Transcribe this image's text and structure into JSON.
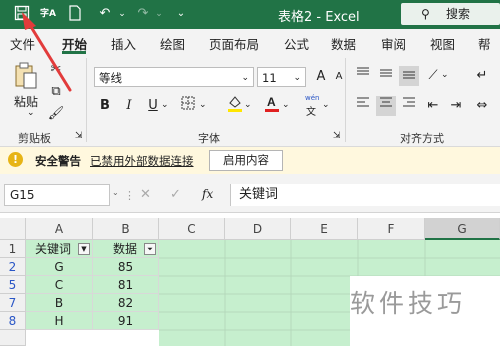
{
  "titlebar": {
    "save_icon": "save-icon",
    "spell_label": "字A",
    "doc_title": "表格2 - Excel",
    "search_placeholder": "搜索(Alt+Q)"
  },
  "tabs": [
    "文件",
    "开始",
    "插入",
    "绘图",
    "页面布局",
    "公式",
    "数据",
    "审阅",
    "视图",
    "帮助"
  ],
  "ribbon": {
    "clipboard": {
      "paste_label": "粘贴",
      "group_label": "剪贴板"
    },
    "font": {
      "font_name": "等线",
      "font_size": "11",
      "grow": "A",
      "shrink": "A",
      "bold": "B",
      "italic": "I",
      "underline": "U",
      "wen": "wén",
      "wen2": "文",
      "group_label": "字体"
    },
    "alignment": {
      "group_label": "对齐方式"
    }
  },
  "warning": {
    "title": "安全警告",
    "message": "已禁用外部数据连接",
    "button": "启用内容"
  },
  "formula": {
    "name_box": "G15",
    "fx": "fx",
    "content": "关键词"
  },
  "sheet": {
    "columns": [
      "A",
      "B",
      "C",
      "D",
      "E",
      "F",
      "G"
    ],
    "rows": [
      {
        "num": "1",
        "a": "关键词",
        "b": "数据"
      },
      {
        "num": "2",
        "a": "G",
        "b": "85"
      },
      {
        "num": "5",
        "a": "C",
        "b": "81"
      },
      {
        "num": "7",
        "a": "B",
        "b": "82"
      },
      {
        "num": "8",
        "a": "H",
        "b": "91"
      }
    ]
  },
  "watermark": "软件技巧",
  "colors": {
    "excel_green": "#217346",
    "highlight": "#c6efce",
    "warning_bg": "#fff8de",
    "arrow": "#e23b3b"
  }
}
